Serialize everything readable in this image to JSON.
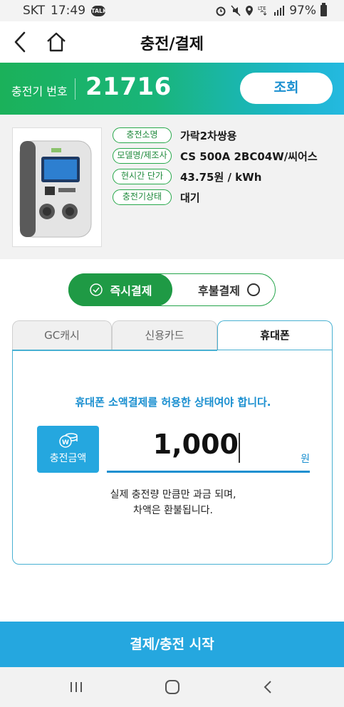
{
  "status_bar": {
    "carrier": "SKT",
    "time": "17:49",
    "battery": "97%"
  },
  "header": {
    "title": "충전/결제"
  },
  "charger": {
    "label": "충전기 번호",
    "number": "21716",
    "lookup_button": "조회"
  },
  "info": [
    {
      "label": "충전소명",
      "value": "가락2차쌍용"
    },
    {
      "label": "모델명/제조사",
      "value": "CS 500A 2BC04W/씨어스"
    },
    {
      "label": "현시간 단가",
      "value": "43.75원 / kWh"
    },
    {
      "label": "충전기상태",
      "value": "대기"
    }
  ],
  "payment_toggle": {
    "instant": "즉시결제",
    "deferred": "후불결제",
    "selected": "instant"
  },
  "tabs": [
    {
      "label": "GC캐시"
    },
    {
      "label": "신용카드"
    },
    {
      "label": "휴대폰"
    }
  ],
  "active_tab": 2,
  "panel": {
    "notice": "휴대폰 소액결제를 허용한 상태여야 합니다.",
    "amount_label": "충전금액",
    "amount_value": "1,000",
    "amount_unit": "원",
    "refund_line1": "실제 충전량 만큼만 과금 되며,",
    "refund_line2": "차액은 환불됩니다."
  },
  "start_button": "결제/충전 시작",
  "colors": {
    "green": "#1f9a45",
    "blue": "#25a7df",
    "text_blue": "#1a8fd0"
  }
}
